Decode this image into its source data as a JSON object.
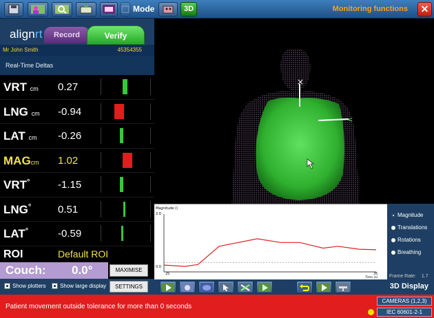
{
  "toolbar": {
    "mode_label": "Mode",
    "btn_3d": "3D",
    "monitoring_label": "Monitoring functions",
    "close_symbol": "✕",
    "icons": [
      "save-icon",
      "patient-icon",
      "search-icon",
      "camera-icon",
      "display-icon",
      "grid-icon",
      "robot-icon"
    ]
  },
  "brand": {
    "logo_part1": "align",
    "logo_part2": "rt",
    "tab_record": "Record",
    "tab_verify": "Verify"
  },
  "patient": {
    "name": "Mr John Smith",
    "id": "45354355"
  },
  "section_title": "Real-Time Deltas",
  "deltas": [
    {
      "label": "VRT",
      "unit": "cm",
      "value": "0.27",
      "bar_color": "#39c639"
    },
    {
      "label": "LNG",
      "unit": "cm",
      "value": "-0.94",
      "bar_color": "#e31c1c"
    },
    {
      "label": "LAT",
      "unit": "cm",
      "value": "-0.26",
      "bar_color": "#39c639"
    },
    {
      "label": "MAG",
      "unit": "cm",
      "value": "1.02",
      "bar_color": "#e31c1c"
    },
    {
      "label": "VRT",
      "unit": "°",
      "value": "-1.15",
      "bar_color": "#39c639"
    },
    {
      "label": "LNG",
      "unit": "°",
      "value": "0.51",
      "bar_color": "#39c639"
    },
    {
      "label": "LAT",
      "unit": "°",
      "value": "-0.59",
      "bar_color": "#39c639"
    }
  ],
  "roi": {
    "label": "ROI",
    "value": "Default ROI"
  },
  "couch": {
    "label": "Couch:",
    "value": "0.0°"
  },
  "buttons": {
    "maximise": "MAXIMISE",
    "settings": "SETTINGS"
  },
  "options": {
    "show_plotters": "Show plotters",
    "show_large_display": "Show large display"
  },
  "plot": {
    "ylabel": "Magnitude ()",
    "ymax_label": "2.0",
    "ymin_label": "0.0",
    "xmin_label": "25",
    "xmax_label": "35",
    "xunit_label": "Time (s)",
    "threshold_value": 0.2,
    "ylim": [
      0.0,
      2.0
    ],
    "xlim": [
      25,
      35
    ],
    "series": {
      "x": [
        25,
        26,
        26.6,
        27.6,
        29.4,
        30.5,
        31.4,
        32.5,
        33.2,
        34.2,
        35
      ],
      "y": [
        0.1,
        0.05,
        0.12,
        0.8,
        1.08,
        0.94,
        0.94,
        0.73,
        0.8,
        0.69,
        0.67
      ]
    }
  },
  "plot_options": [
    {
      "label": "Magnitude",
      "selected": true
    },
    {
      "label": "Translations",
      "selected": false
    },
    {
      "label": "Rotations",
      "selected": false
    },
    {
      "label": "Breathing",
      "selected": false
    }
  ],
  "frame_rate": {
    "label": "Frame Rate:",
    "value": "1.7"
  },
  "bottom_toolbar": {
    "display_label": "3D Display",
    "icons": [
      "play-icon",
      "camera-icon",
      "surface-icon",
      "pointer-icon",
      "reference-icon",
      "play-icon",
      "undo-icon",
      "play-icon",
      "couch-icon"
    ]
  },
  "status": {
    "message": "Patient movement outside tolerance for more than 0 seconds",
    "cameras": "CAMERAS (1,2,3)",
    "standard": "IEC 60601-2-1"
  }
}
